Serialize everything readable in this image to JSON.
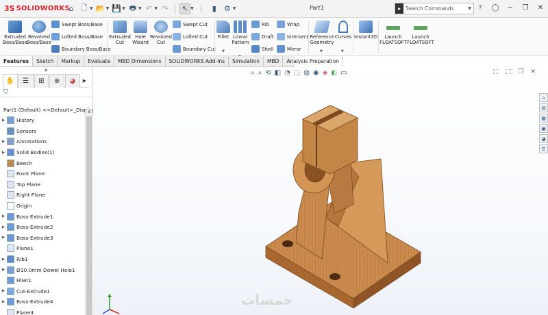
{
  "app": {
    "brand": "SOLIDWORKS",
    "document_title": "Part1",
    "search_placeholder": "Search Commands"
  },
  "ribbon": {
    "extruded_boss": "Extruded\nBoss/Base",
    "revolved_boss": "Revolved\nBoss/Base",
    "swept_boss": "Swept Boss/Base",
    "lofted_boss": "Lofted Boss/Base",
    "boundary_boss": "Boundary Boss/Base",
    "extruded_cut": "Extruded\nCut",
    "hole_wizard": "Hole\nWizard",
    "revolved_cut": "Revolved\nCut",
    "swept_cut": "Swept Cut",
    "lofted_cut": "Lofted Cut",
    "boundary_cut": "Boundary Cut",
    "fillet": "Fillet",
    "linear_pattern": "Linear\nPattern",
    "rib": "Rib",
    "draft": "Draft",
    "shell": "Shell",
    "wrap": "Wrap",
    "intersect": "Intersect",
    "mirror": "Mirror",
    "reference_geometry": "Reference\nGeometry",
    "curves": "Curves",
    "instant3d": "Instant3D",
    "launch1": "Launch\nFLOATSOFT",
    "launch2": "Launch\nFLOATSOFT"
  },
  "tabs": [
    "Features",
    "Sketch",
    "Markup",
    "Evaluate",
    "MBD Dimensions",
    "SOLIDWORKS Add-Ins",
    "Simulation",
    "MBD",
    "Analysis Preparation"
  ],
  "tree": {
    "root": "Part1 (Default) <<Default>_Display",
    "items": [
      {
        "label": "History",
        "exp": true
      },
      {
        "label": "Sensors",
        "exp": false
      },
      {
        "label": "Annotations",
        "exp": true
      },
      {
        "label": "Solid Bodies(1)",
        "exp": true
      },
      {
        "label": "Beech",
        "exp": false
      },
      {
        "label": "Front Plane",
        "exp": false
      },
      {
        "label": "Top Plane",
        "exp": false
      },
      {
        "label": "Right Plane",
        "exp": false
      },
      {
        "label": "Origin",
        "exp": false
      },
      {
        "label": "Boss-Extrude1",
        "exp": true
      },
      {
        "label": "Boss-Extrude2",
        "exp": true
      },
      {
        "label": "Boss-Extrude3",
        "exp": true
      },
      {
        "label": "Plane1",
        "exp": false
      },
      {
        "label": "Rib1",
        "exp": true
      },
      {
        "label": "Ø10.0mm Dowel Hole1",
        "exp": true
      },
      {
        "label": "Fillet1",
        "exp": false
      },
      {
        "label": "Cut-Extrude1",
        "exp": true
      },
      {
        "label": "Boss-Extrude4",
        "exp": true
      },
      {
        "label": "Plane4",
        "exp": false
      }
    ]
  },
  "watermark": "خمسات",
  "colors": {
    "wood": "#c8884a",
    "wood_dark": "#9a5f2c",
    "wood_light": "#dca56a",
    "brand_red": "#d6262b"
  }
}
